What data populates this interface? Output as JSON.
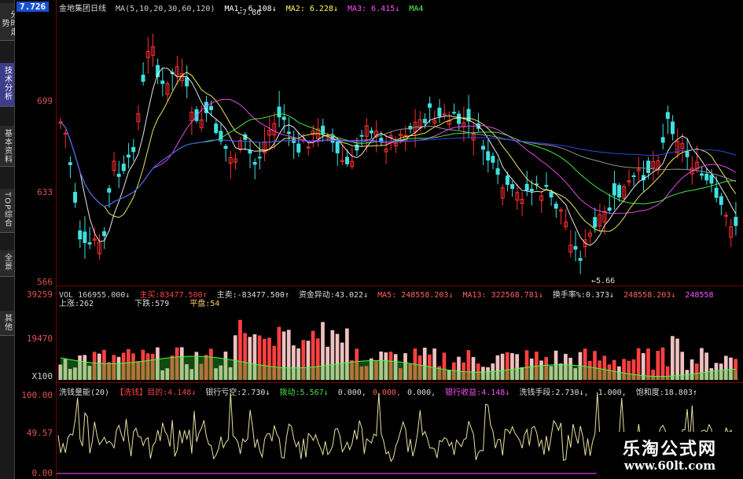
{
  "sidebar": {
    "tabs": [
      {
        "label": "分时走势",
        "active": false
      },
      {
        "label": "技术分析",
        "active": true
      },
      {
        "label": "基本资料",
        "active": false
      },
      {
        "label": "TOP综合",
        "active": false
      },
      {
        "label": "全景",
        "active": false
      },
      {
        "label": "其他",
        "active": false
      }
    ]
  },
  "current_price": "7.726",
  "price_axis": [
    "699",
    "633",
    "566"
  ],
  "volume_axis": [
    "39259",
    "19470",
    "X100"
  ],
  "indicator_axis": [
    "100.00",
    "49.57",
    "0.00"
  ],
  "main_header": {
    "stock": "金地集团",
    "period": "日线",
    "ma_params": "MA(5,10,20,30,60,120)",
    "ma1": "MA1: 6.108↓",
    "ma2": "MA2: 6.228↓",
    "ma3": "MA3: 6.415↓",
    "ma4": "MA4"
  },
  "chart_annotations": {
    "high": "7.66",
    "low": "5.66"
  },
  "volume_header": {
    "vol": "VOL 166955.000↓",
    "main_buy_label": "主买:",
    "main_buy": "83477.500↑",
    "main_sell_label": "主卖:",
    "main_sell": "-83477.500↑",
    "fund_label": "资金异动:",
    "fund_value": "43.022↓",
    "ma5": "MA5: 248558.203↓",
    "ma13": "MA13: 322568.781↓",
    "turnover_label": "换手率%:",
    "turnover": "0.373↓",
    "extra1": "248558.203↓",
    "extra2": "248558"
  },
  "volume_sub": {
    "up": "上涨:262",
    "down": "下跌:579",
    "flat": "平盘:54"
  },
  "indicator_header": {
    "name": "洗钱量能(20)",
    "tag": "【洗钱】",
    "target_label": "目的:",
    "target": "4.148↓",
    "bank_short_label": "银行亏空:",
    "bank_short": "2.730↓",
    "push_label": "拨动:",
    "push": "5.567↓",
    "v0a": "0.000,",
    "v0b": "0.000,",
    "v0c": "0.000,",
    "bank_income_label": "银行收益:",
    "bank_income": "4.148↓",
    "means_label": "洗钱手段:",
    "means": "2.730↓,",
    "v1": "1.000,",
    "saturation_label": "饱和度:",
    "saturation": "18.803↑"
  },
  "watermark": {
    "title": "乐淘公式网",
    "url": "www.60lt.com"
  },
  "colors": {
    "up": "#ff3030",
    "down": "#40e0e0",
    "vol_up": "#ff4040",
    "vol_down": "#f0c0c0",
    "green_fill": "#30d030"
  }
}
